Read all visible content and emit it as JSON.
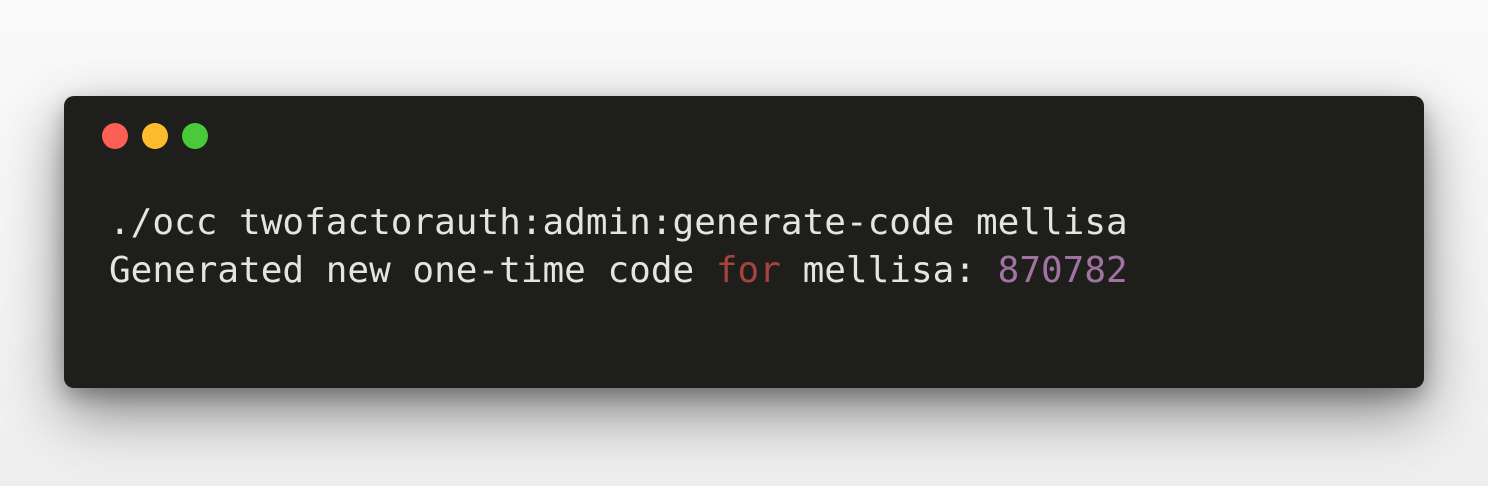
{
  "window": {
    "controls": {
      "close_icon": "red-circle",
      "minimize_icon": "yellow-circle",
      "zoom_icon": "green-circle"
    }
  },
  "terminal": {
    "command_line": "./occ twofactorauth:admin:generate-code mellisa",
    "output": {
      "prefix": "Generated new one-time code ",
      "keyword": "for",
      "middle": " mellisa: ",
      "code": "870782"
    }
  },
  "colors": {
    "background": "#1e1e1b",
    "text": "#e4e4e0",
    "keyword": "#a5443e",
    "number": "#a173a2",
    "close": "#fd5f57",
    "minimize": "#fdbb2e",
    "zoom": "#4ac93a"
  }
}
